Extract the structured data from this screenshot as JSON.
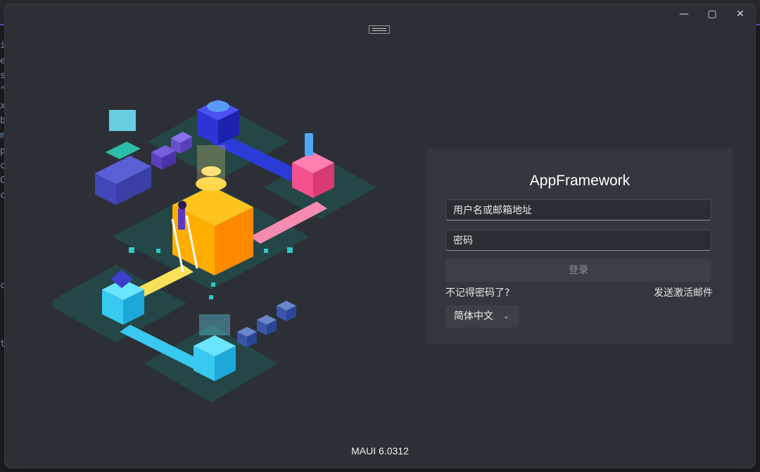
{
  "background_editor": {
    "gutter_chars": [
      "i",
      "e",
      "s",
      "\"",
      "x",
      "b",
      "m",
      "p",
      "c",
      "C",
      "c",
      "c",
      "t"
    ]
  },
  "window": {
    "controls": {
      "minimize": "—",
      "maximize": "▢",
      "close": "✕"
    }
  },
  "login": {
    "app_title": "AppFramework",
    "username_placeholder": "用户名或邮箱地址",
    "password_placeholder": "密码",
    "login_button": "登录",
    "forgot_password_link": "不记得密码了?",
    "send_activation_link": "发送激活邮件",
    "language_selected": "简体中文"
  },
  "footer": {
    "version": "MAUI 6.0312"
  },
  "colors": {
    "window_bg": "#2c2f36",
    "card_bg": "#33363e",
    "accent_purple": "#6c5bd4"
  }
}
